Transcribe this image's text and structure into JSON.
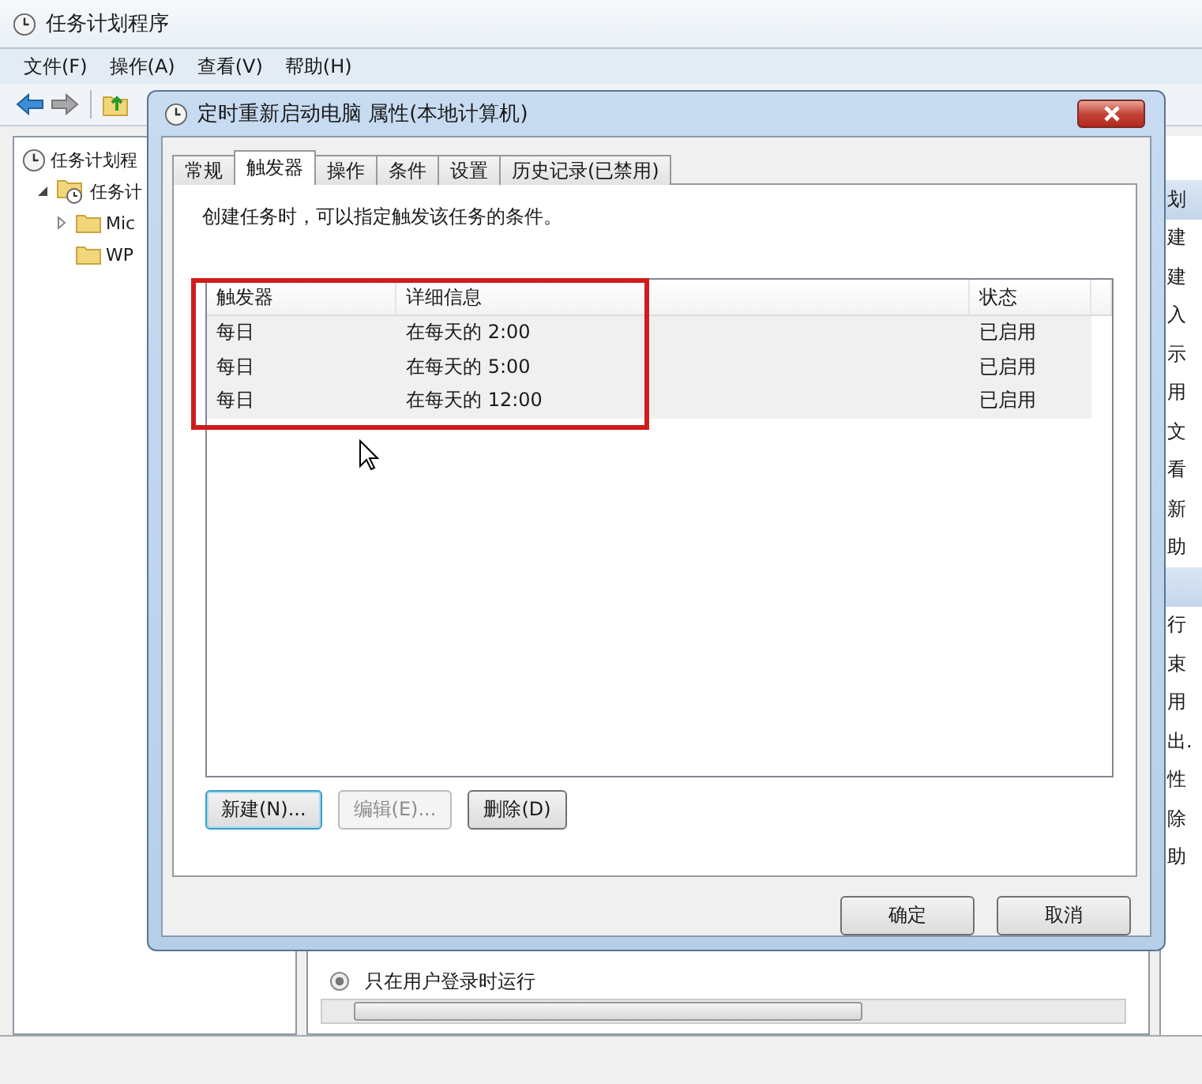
{
  "main_window": {
    "title": "任务计划程序",
    "menu": [
      "文件(F)",
      "操作(A)",
      "查看(V)",
      "帮助(H)"
    ],
    "tree": [
      {
        "label": "任务计划程",
        "kind": "clock",
        "children": [
          {
            "label": "任务计",
            "kind": "clock-folder",
            "expanded": true,
            "children": [
              {
                "label": "Mic",
                "kind": "folder",
                "expanded": false
              },
              {
                "label": "WP",
                "kind": "folder"
              }
            ]
          }
        ]
      }
    ],
    "actions": [
      {
        "text": "划",
        "kind": "header"
      },
      {
        "text": "建",
        "kind": "item"
      },
      {
        "text": "建",
        "kind": "item"
      },
      {
        "text": "入",
        "kind": "item"
      },
      {
        "text": "示",
        "kind": "item"
      },
      {
        "text": "用",
        "kind": "item"
      },
      {
        "text": "文",
        "kind": "item"
      },
      {
        "text": "看",
        "kind": "item"
      },
      {
        "text": "新",
        "kind": "item"
      },
      {
        "text": "助",
        "kind": "item"
      },
      {
        "kind": "header"
      },
      {
        "text": "行",
        "kind": "item"
      },
      {
        "text": "束",
        "kind": "item"
      },
      {
        "text": "用",
        "kind": "item"
      },
      {
        "text": "出.",
        "kind": "item"
      },
      {
        "text": "性",
        "kind": "item"
      },
      {
        "text": "除",
        "kind": "item"
      },
      {
        "text": "助",
        "kind": "item"
      }
    ],
    "lower_pane": {
      "radio": {
        "label": "只在用户登录时运行",
        "selected": true
      }
    }
  },
  "dialog": {
    "title": "定时重新启动电脑 属性(本地计算机)",
    "tabs": [
      {
        "label": "常规",
        "selected": false
      },
      {
        "label": "触发器",
        "selected": true
      },
      {
        "label": "操作",
        "selected": false
      },
      {
        "label": "条件",
        "selected": false
      },
      {
        "label": "设置",
        "selected": false
      },
      {
        "label": "历史记录(已禁用)",
        "selected": false
      }
    ],
    "description": "创建任务时，可以指定触发该任务的条件。",
    "table": {
      "columns": [
        "触发器",
        "详细信息",
        "状态"
      ],
      "rows": [
        [
          "每日",
          "在每天的 2:00",
          "已启用"
        ],
        [
          "每日",
          "在每天的 5:00",
          "已启用"
        ],
        [
          "每日",
          "在每天的 12:00",
          "已启用"
        ]
      ]
    },
    "list_buttons": [
      {
        "label": "新建(N)...",
        "kind": "default",
        "disabled": false
      },
      {
        "label": "编辑(E)...",
        "kind": "normal",
        "disabled": true
      },
      {
        "label": "删除(D)",
        "kind": "normal",
        "disabled": false
      }
    ],
    "footer_buttons": [
      {
        "label": "确定",
        "disabled": false
      },
      {
        "label": "取消",
        "disabled": false
      }
    ]
  }
}
